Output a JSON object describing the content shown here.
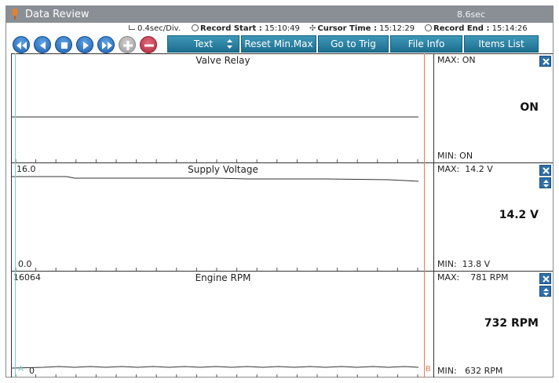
{
  "window": {
    "title": "Data Review",
    "scale_readout": "8.6sec"
  },
  "info": {
    "time_div": "0.4sec/Div.",
    "record_start_label": "Record Start :",
    "record_start_value": "15:10:49",
    "cursor_time_label": "Cursor Time :",
    "cursor_time_value": "15:12:29",
    "record_end_label": "Record End :",
    "record_end_value": "15:14:26"
  },
  "toolbar": {
    "text_label": "Text",
    "reset_label": "Reset Min.Max",
    "goto_label": "Go to Trig",
    "fileinfo_label": "File Info",
    "items_label": "Items List"
  },
  "panels": [
    {
      "name": "Valve Relay",
      "scale_max": "",
      "scale_min": "",
      "max_text": "MAX: ON",
      "min_text": "MIN: ON",
      "current": "ON"
    },
    {
      "name": "Supply Voltage",
      "scale_max": "16.0",
      "scale_min": "0.0",
      "max_text": "MAX:  14.2 V",
      "min_text": "MIN:  13.8 V",
      "current": "14.2 V"
    },
    {
      "name": "Engine RPM",
      "scale_max": "16064",
      "scale_min": "0",
      "max_text": "MAX:    781 RPM",
      "min_text": "MIN:   632 RPM",
      "current": "732 RPM"
    }
  ],
  "cursors": {
    "a_label": "A",
    "b_label": "B",
    "a_color": "#7fc8d8",
    "b_color": "#e0805a"
  },
  "colors": {
    "titlebar": "#8a8f96",
    "button_blue": "#1d6e8e",
    "nav_blue": "#1e5fae"
  }
}
